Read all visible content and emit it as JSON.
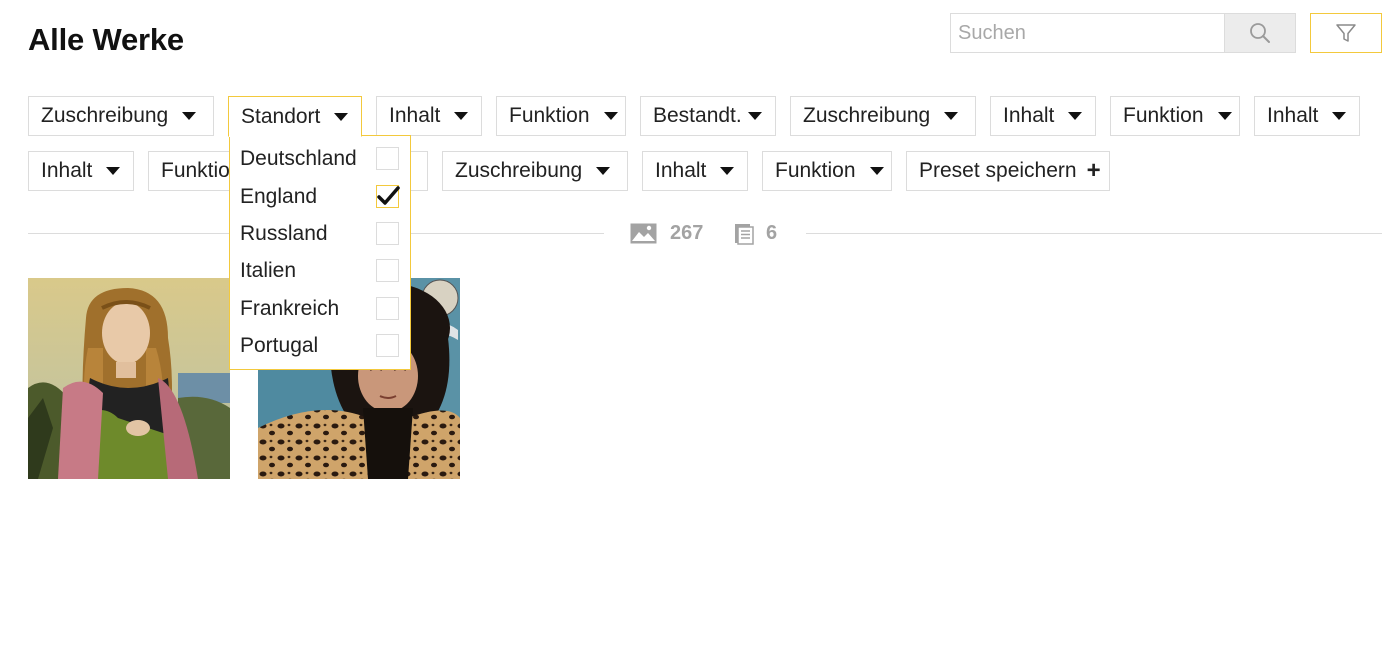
{
  "page": {
    "title": "Alle Werke"
  },
  "search": {
    "placeholder": "Suchen",
    "value": ""
  },
  "icons": {
    "search": "search-icon",
    "filter": "filter-icon",
    "caret": "caret-down-icon",
    "plus": "plus-icon",
    "checkmark": "checkmark-icon",
    "images": "image-icon",
    "documents": "document-icon"
  },
  "colors": {
    "accent": "#f3c93d",
    "border": "#dcdcdc",
    "muted": "#a3a3a3"
  },
  "filters": {
    "row1": [
      "Zuschreibung",
      "Standort",
      "Inhalt",
      "Funktion",
      "Bestandt.",
      "Zuschreibung",
      "Inhalt",
      "Funktion",
      "Inhalt"
    ],
    "row2": [
      "Inhalt",
      "Funktion",
      "Zuschreibung",
      "Inhalt",
      "Funktion"
    ],
    "preset_label": "Preset speichern",
    "active": "Standort"
  },
  "dropdown": {
    "options": [
      {
        "label": "Deutschland",
        "checked": false
      },
      {
        "label": "England",
        "checked": true
      },
      {
        "label": "Russland",
        "checked": false
      },
      {
        "label": "Italien",
        "checked": false
      },
      {
        "label": "Frankreich",
        "checked": false
      },
      {
        "label": "Portugal",
        "checked": false
      }
    ]
  },
  "results": {
    "image_count": "267",
    "document_count": "6"
  },
  "artworks": [
    {
      "kind": "portrait-woman"
    },
    {
      "kind": "portrait-man"
    }
  ]
}
